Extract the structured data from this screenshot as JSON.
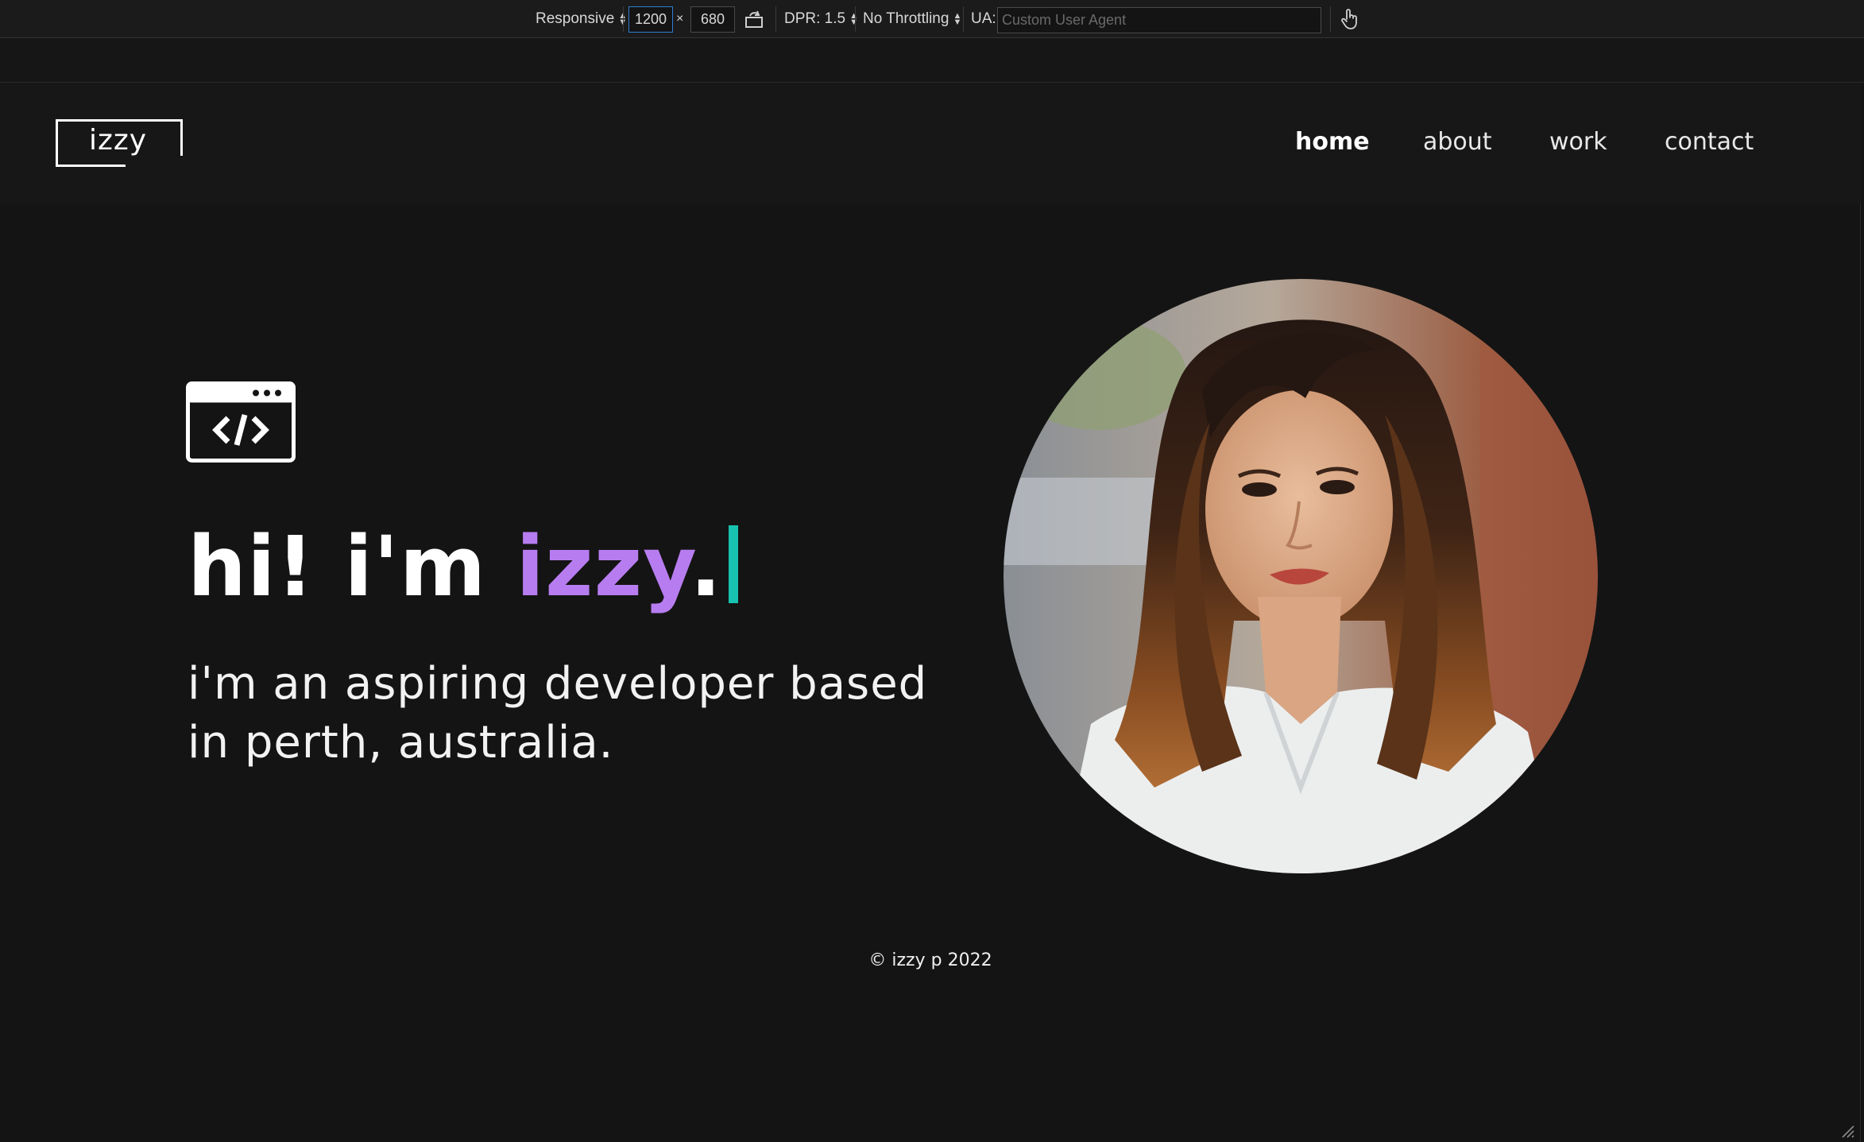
{
  "devtools": {
    "device_mode": "Responsive",
    "width": "1200",
    "times": "×",
    "height": "680",
    "dpr_label": "DPR: 1.5",
    "throttling": "No Throttling",
    "ua_label": "UA:",
    "ua_placeholder": "Custom User Agent",
    "icons": [
      "rotate-icon",
      "touch-hand-icon"
    ]
  },
  "header": {
    "logo": "izzy",
    "nav": [
      {
        "label": "home",
        "active": true
      },
      {
        "label": "about",
        "active": false
      },
      {
        "label": "work",
        "active": false
      },
      {
        "label": "contact",
        "active": false
      }
    ]
  },
  "hero": {
    "icon": "code-window-icon",
    "greeting": "hi! i'm ",
    "name": "izzy",
    "punct": ".",
    "subtitle": "i'm an aspiring developer based in perth, australia.",
    "accent_name_color": "#b77df0",
    "accent_cursor_color": "#17c2b0"
  },
  "footer": {
    "copyright": "© izzy p 2022"
  }
}
